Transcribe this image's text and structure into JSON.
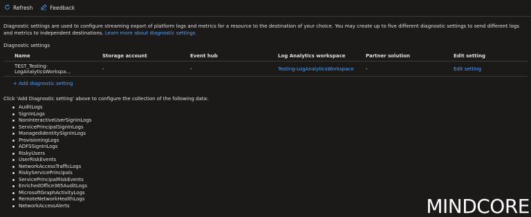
{
  "toolbar": {
    "refresh_label": "Refresh",
    "feedback_label": "Feedback"
  },
  "description": {
    "text": "Diagnostic settings are used to configure streaming export of platform logs and metrics for a resource to the destination of your choice. You may create up to five different diagnostic settings to send different logs and metrics to independent destinations.",
    "link": "Learn more about diagnostic settings"
  },
  "section_title": "Diagnostic settings",
  "table": {
    "headers": [
      "Name",
      "Storage account",
      "Event hub",
      "Log Analytics workspace",
      "Partner solution",
      "Edit setting"
    ],
    "rows": [
      {
        "name": "TEST_Testing-LogAnalyticsWorkspa...",
        "storage": "-",
        "eventhub": "-",
        "workspace": "Testing-LogAnalyticsWorkspace",
        "partner": "-",
        "edit": "Edit setting"
      }
    ]
  },
  "add_setting_label": "+ Add diagnostic setting",
  "click_text": "Click 'Add Diagnostic setting' above to configure the collection of the following data:",
  "logs": [
    "AuditLogs",
    "SignInLogs",
    "NonInteractiveUserSignInLogs",
    "ServicePrincipalSignInLogs",
    "ManagedIdentitySignInLogs",
    "ProvisioningLogs",
    "ADFSSignInLogs",
    "RiskyUsers",
    "UserRiskEvents",
    "NetworkAccessTrafficLogs",
    "RiskyServicePrincipals",
    "ServicePrincipalRiskEvents",
    "EnrichedOffice365AuditLogs",
    "MicrosoftGraphActivityLogs",
    "RemoteNetworkHealthLogs",
    "NetworkAccessAlerts"
  ],
  "watermark": "MINDCORE",
  "colors": {
    "background": "#1b1a19",
    "text": "#e1dfdd",
    "link": "#4da3ff",
    "border": "#3b3a39"
  }
}
